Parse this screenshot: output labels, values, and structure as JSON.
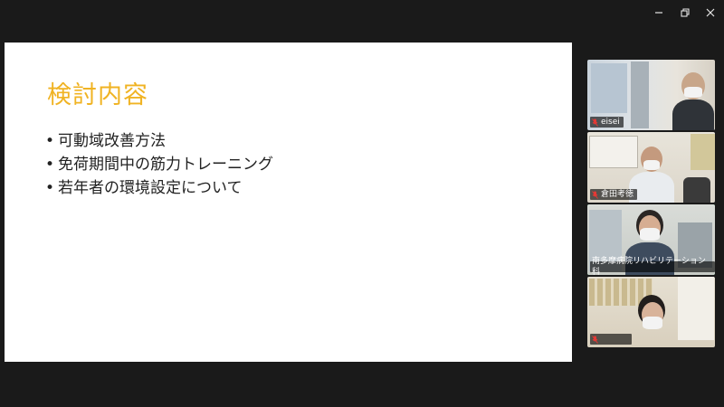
{
  "window_controls": {
    "minimize": "minimize",
    "restore": "restore",
    "close": "close"
  },
  "slide": {
    "title": "検討内容",
    "bullet_marker": "•",
    "bullets": [
      "可動域改善方法",
      "免荷期間中の筋力トレーニング",
      "若年者の環境設定について"
    ]
  },
  "participants": [
    {
      "name": "eisei",
      "muted": true,
      "active": false
    },
    {
      "name": "倉田考徳",
      "muted": true,
      "active": false
    },
    {
      "name": "南多摩病院リハビリテーション科",
      "muted": false,
      "active": true
    },
    {
      "name": "",
      "muted": true,
      "active": false
    }
  ],
  "colors": {
    "title": "#f0b323",
    "active_speaker": "#2ecc71",
    "muted_mic": "#e53935"
  }
}
